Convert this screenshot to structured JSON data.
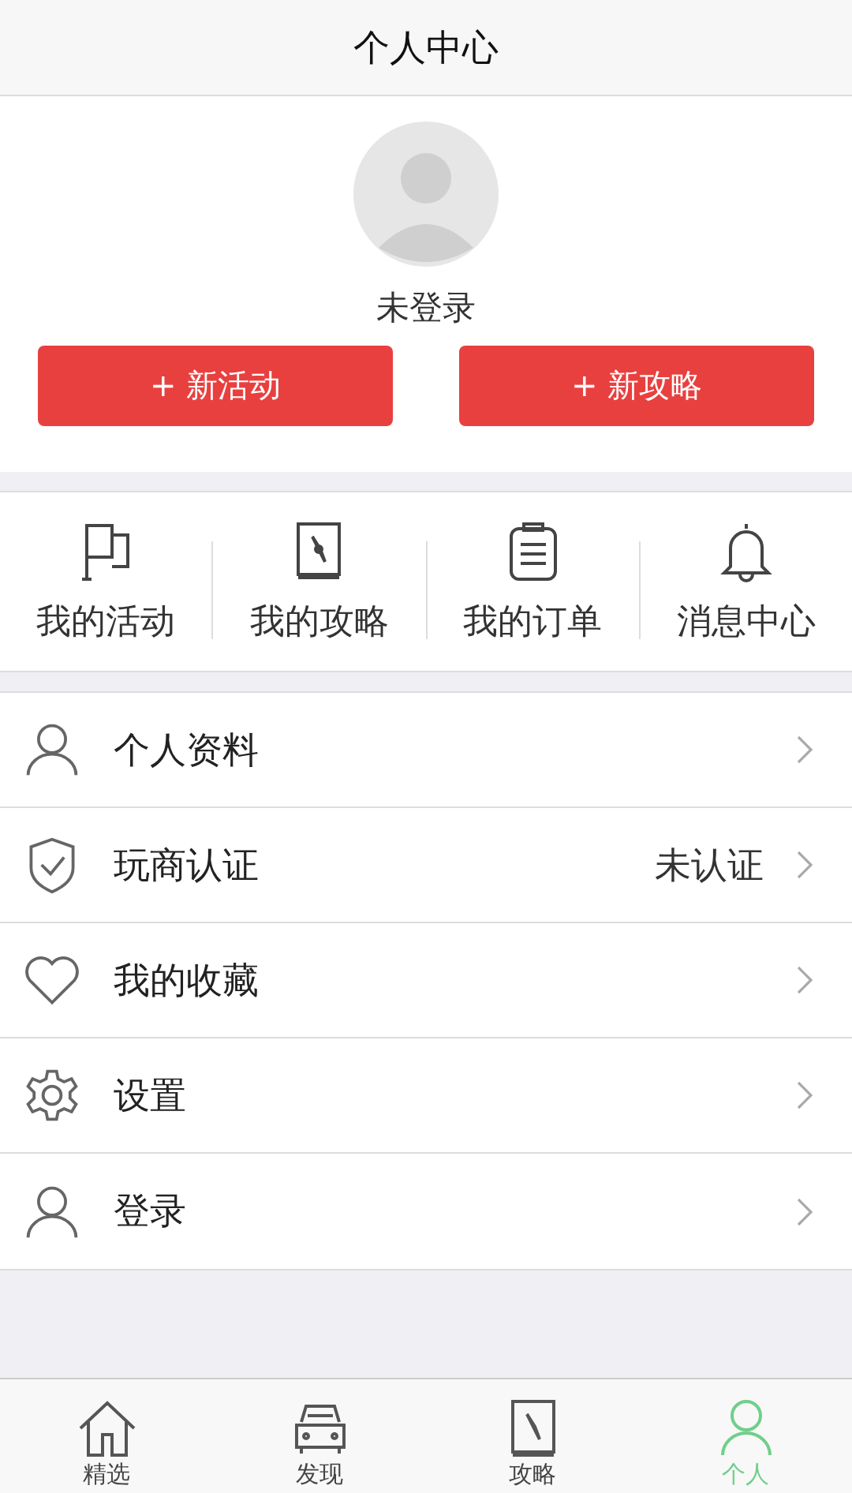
{
  "header": {
    "title": "个人中心"
  },
  "profile": {
    "name": "未登录",
    "buttons": [
      "+ 新活动",
      "+ 新攻略"
    ]
  },
  "shortcuts": [
    {
      "kind": "flag",
      "label": "我的活动"
    },
    {
      "kind": "book",
      "label": "我的攻略"
    },
    {
      "kind": "clipboard",
      "label": "我的订单"
    },
    {
      "kind": "bell",
      "label": "消息中心"
    }
  ],
  "menu": [
    {
      "kind": "person",
      "label": "个人资料"
    },
    {
      "kind": "shield",
      "label": "玩商认证",
      "value": "未认证"
    },
    {
      "kind": "heart",
      "label": "我的收藏"
    },
    {
      "kind": "gear",
      "label": "设置"
    },
    {
      "kind": "person",
      "label": "登录"
    }
  ],
  "tabbar": [
    {
      "kind": "home",
      "label": "精选",
      "selected": false
    },
    {
      "kind": "car",
      "label": "发现",
      "selected": false
    },
    {
      "kind": "book",
      "label": "攻略",
      "selected": false
    },
    {
      "kind": "person",
      "label": "个人",
      "selected": true
    }
  ]
}
